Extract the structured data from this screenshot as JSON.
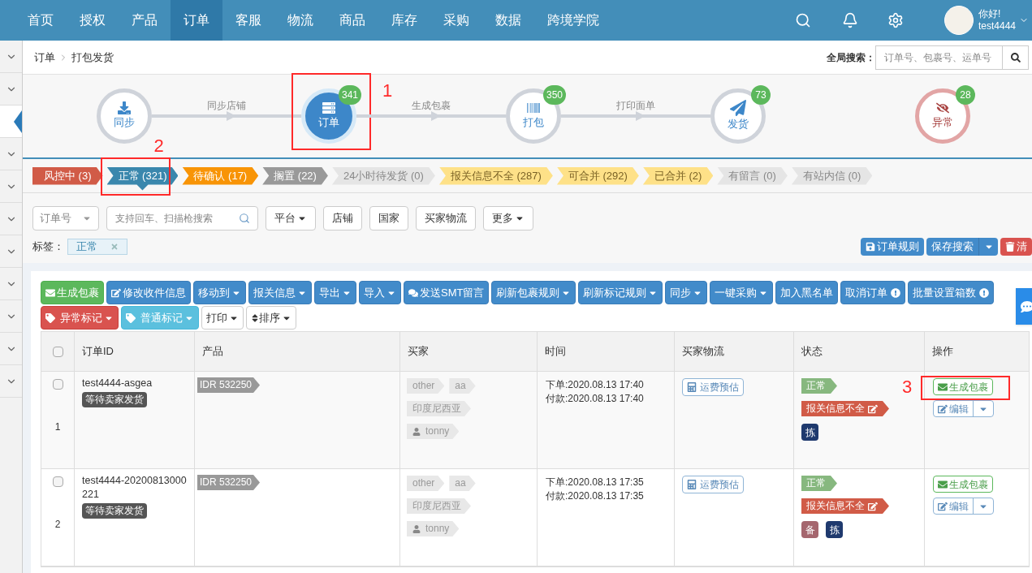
{
  "nav": {
    "items": [
      {
        "label": "首页",
        "selected": false
      },
      {
        "label": "授权",
        "selected": false
      },
      {
        "label": "产品",
        "selected": false
      },
      {
        "label": "订单",
        "selected": true
      },
      {
        "label": "客服",
        "selected": false
      },
      {
        "label": "物流",
        "selected": false
      },
      {
        "label": "商品",
        "selected": false
      },
      {
        "label": "库存",
        "selected": false
      },
      {
        "label": "采购",
        "selected": false
      },
      {
        "label": "数据",
        "selected": false
      },
      {
        "label": "跨境学院",
        "selected": false
      }
    ],
    "greeting": "你好!",
    "user": "test4444"
  },
  "sidebar": {
    "items": [
      {
        "selected": false
      },
      {
        "selected": false
      },
      {
        "selected": true
      },
      {
        "selected": false
      },
      {
        "selected": false
      },
      {
        "selected": false
      },
      {
        "selected": false
      },
      {
        "selected": false
      },
      {
        "selected": false
      },
      {
        "selected": false
      },
      {
        "selected": false
      }
    ]
  },
  "breadcrumb": [
    "订单",
    "打包发货"
  ],
  "global_search": {
    "label": "全局搜索：",
    "placeholder": "订单号、包裹号、运单号"
  },
  "flow": {
    "steps": [
      {
        "label": "同步",
        "kind": "normal",
        "link_label": "同步店铺"
      },
      {
        "label": "订单",
        "kind": "active",
        "count": "341",
        "link_label": "生成包裹",
        "annotation": "1"
      },
      {
        "label": "打包",
        "kind": "normal",
        "count": "350",
        "link_label": "打印面单"
      },
      {
        "label": "发货",
        "kind": "normal",
        "count": "73"
      },
      {
        "label": "异常",
        "kind": "error",
        "count": "28"
      }
    ]
  },
  "status_tabs": [
    {
      "label": "风控中 (3)",
      "color": "#d15b47",
      "selected": false
    },
    {
      "label": "正常 (321)",
      "color": "#3a87ad",
      "selected": true,
      "annotation": "2"
    },
    {
      "label": "待确认 (17)",
      "color": "#f89406",
      "selected": false
    },
    {
      "label": "搁置 (22)",
      "color": "#999999",
      "selected": false
    },
    {
      "label": "24小时待发货 (0)",
      "color": "#e5e5e5",
      "selected": false
    },
    {
      "label": "报关信息不全 (287)",
      "color": "#fee188",
      "selected": false
    },
    {
      "label": "可合并 (292)",
      "color": "#fee188",
      "selected": false
    },
    {
      "label": "已合并 (2)",
      "color": "#fee188",
      "selected": false
    },
    {
      "label": "有留言 (0)",
      "color": "#e5e5e5",
      "selected": false
    },
    {
      "label": "有站内信 (0)",
      "color": "#e5e5e5",
      "selected": false
    }
  ],
  "filters": {
    "field": "订单号",
    "placeholder": "支持回车、扫描枪搜索",
    "buttons": [
      {
        "label": "平台",
        "dropdown": true
      },
      {
        "label": "店铺",
        "dropdown": false
      },
      {
        "label": "国家",
        "dropdown": false
      },
      {
        "label": "买家物流",
        "dropdown": false
      },
      {
        "label": "更多",
        "dropdown": true
      }
    ]
  },
  "tags": {
    "label": "标签：",
    "items": [
      "正常"
    ]
  },
  "search_actions": [
    {
      "label": "订单规则",
      "kind": "primary"
    },
    {
      "label": "保存搜索",
      "kind": "split"
    },
    {
      "label": "清",
      "kind": "danger"
    }
  ],
  "toolbar": {
    "rows": [
      [
        {
          "label": "生成包裹",
          "kind": "success",
          "dropdown": false
        },
        {
          "label": "修改收件信息",
          "kind": "primary",
          "dropdown": false
        },
        {
          "label": "移动到",
          "kind": "primary",
          "dropdown": true
        },
        {
          "label": "报关信息",
          "kind": "primary",
          "dropdown": true
        },
        {
          "label": "导出",
          "kind": "primary",
          "dropdown": true
        },
        {
          "label": "导入",
          "kind": "primary",
          "dropdown": true
        },
        {
          "label": "发送SMT留言",
          "kind": "primary",
          "dropdown": false
        },
        {
          "label": "刷新包裹规则",
          "kind": "primary",
          "dropdown": true
        },
        {
          "label": "刷新标记规则",
          "kind": "primary",
          "dropdown": true
        },
        {
          "label": "同步",
          "kind": "primary",
          "dropdown": true
        },
        {
          "label": "一键采购",
          "kind": "primary",
          "dropdown": true
        },
        {
          "label": "加入黑名单",
          "kind": "primary",
          "dropdown": false
        },
        {
          "label": "取消订单",
          "kind": "primary",
          "dropdown": false
        },
        {
          "label": "批量设置箱数",
          "kind": "primary",
          "dropdown": false
        }
      ],
      [
        {
          "label": "异常标记",
          "kind": "danger",
          "dropdown": true
        },
        {
          "label": "普通标记",
          "kind": "info",
          "dropdown": true
        },
        {
          "label": "打印",
          "kind": "default",
          "dropdown": true
        },
        {
          "label": "排序",
          "kind": "default",
          "dropdown": true
        }
      ]
    ]
  },
  "table": {
    "select_all_checked": false,
    "columns": [
      "订单ID",
      "产品",
      "买家",
      "时间",
      "买家物流",
      "状态",
      "操作"
    ],
    "rows": [
      {
        "checked": false,
        "index": "1",
        "order_id": "test4444-asgea",
        "order_status": "等待卖家发货",
        "product": "IDR 532250",
        "buyer_tags": [
          "other",
          "aa"
        ],
        "country": "印度尼西亚",
        "buyer": "tonny",
        "times": [
          "下单:2020.08.13 17:40",
          "付款:2020.08.13 17:40"
        ],
        "logistics": "运费预估",
        "status_tags": [
          {
            "label": "正常",
            "kind": "ok"
          },
          {
            "label": "报关信息不全",
            "kind": "error"
          }
        ],
        "marks": [
          {
            "label": "拣",
            "color": "#1f3a6e"
          }
        ],
        "action": "生成包裹",
        "edit": "编辑",
        "annotation": "3"
      },
      {
        "checked": false,
        "index": "2",
        "order_id": "test4444-20200813000221",
        "order_status": "等待卖家发货",
        "product": "IDR 532250",
        "buyer_tags": [
          "other",
          "aa"
        ],
        "country": "印度尼西亚",
        "buyer": "tonny",
        "times": [
          "下单:2020.08.13 17:35",
          "付款:2020.08.13 17:35"
        ],
        "logistics": "运费预估",
        "status_tags": [
          {
            "label": "正常",
            "kind": "ok"
          },
          {
            "label": "报关信息不全",
            "kind": "error"
          }
        ],
        "marks": [
          {
            "label": "备",
            "color": "#a5666e"
          },
          {
            "label": "拣",
            "color": "#1f3a6e"
          }
        ],
        "action": "生成包裹",
        "edit": "编辑"
      }
    ]
  }
}
